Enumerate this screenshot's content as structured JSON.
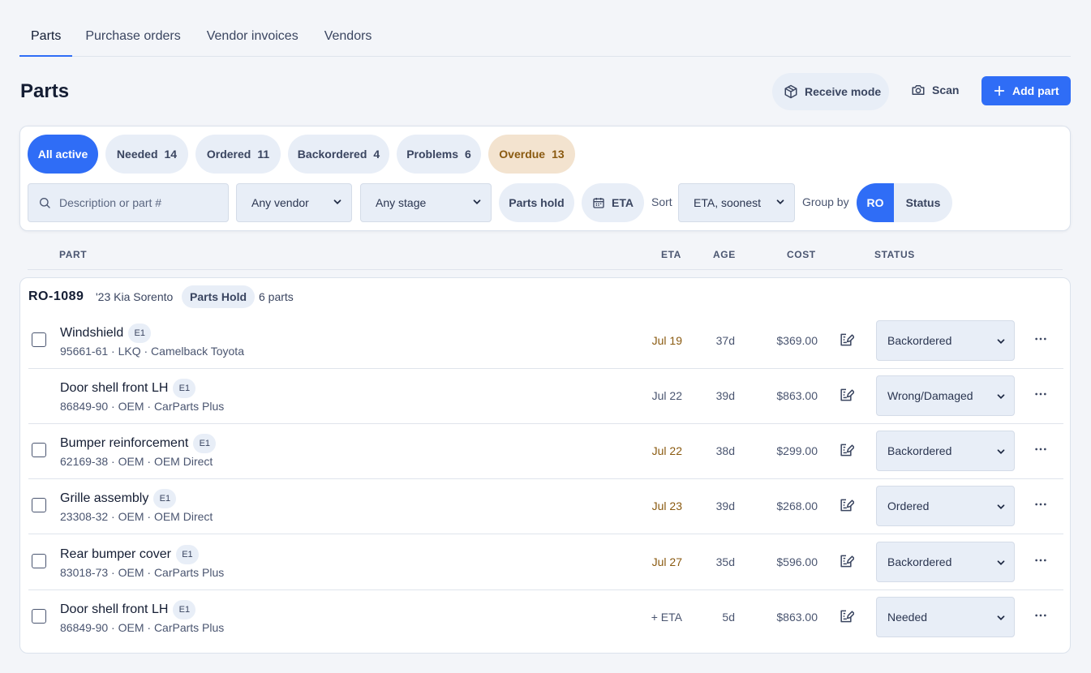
{
  "tabs": [
    "Parts",
    "Purchase orders",
    "Vendor invoices",
    "Vendors"
  ],
  "page_title": "Parts",
  "header_buttons": {
    "receive": "Receive mode",
    "scan": "Scan",
    "add": "Add part"
  },
  "filter_chips": [
    {
      "label": "All active",
      "count": ""
    },
    {
      "label": "Needed",
      "count": "14"
    },
    {
      "label": "Ordered",
      "count": "11"
    },
    {
      "label": "Backordered",
      "count": "4"
    },
    {
      "label": "Problems",
      "count": "6"
    },
    {
      "label": "Overdue",
      "count": "13"
    }
  ],
  "filters": {
    "search_placeholder": "Description or part #",
    "vendor": "Any vendor",
    "stage": "Any stage",
    "parts_hold": "Parts hold",
    "eta": "ETA",
    "sort_label": "Sort",
    "sort_value": "ETA, soonest",
    "group_label": "Group by",
    "group_options": [
      "RO",
      "Status"
    ]
  },
  "columns": {
    "part": "PART",
    "eta": "ETA",
    "age": "AGE",
    "cost": "COST",
    "status": "STATUS"
  },
  "group": {
    "ro": "RO-1089",
    "vehicle": "'23 Kia Sorento",
    "badge": "Parts Hold",
    "count": "6 parts"
  },
  "rows": [
    {
      "name": "Windshield",
      "tag": "E1",
      "sub": "95661-61 · LKQ · Camelback Toyota",
      "eta": "Jul 19",
      "age": "37d",
      "cost": "$369.00",
      "status": "Backordered"
    },
    {
      "name": "Door shell front LH",
      "tag": "E1",
      "sub": "86849-90 · OEM · CarParts Plus",
      "eta": "Jul 22",
      "age": "39d",
      "cost": "$863.00",
      "status": "Wrong/Damaged"
    },
    {
      "name": "Bumper reinforcement",
      "tag": "E1",
      "sub": "62169-38 · OEM · OEM Direct",
      "eta": "Jul 22",
      "age": "38d",
      "cost": "$299.00",
      "status": "Backordered"
    },
    {
      "name": "Grille assembly",
      "tag": "E1",
      "sub": "23308-32 · OEM · OEM Direct",
      "eta": "Jul 23",
      "age": "39d",
      "cost": "$268.00",
      "status": "Ordered"
    },
    {
      "name": "Rear bumper cover",
      "tag": "E1",
      "sub": "83018-73 · OEM · CarParts Plus",
      "eta": "Jul 27",
      "age": "35d",
      "cost": "$596.00",
      "status": "Backordered"
    },
    {
      "name": "Door shell front LH",
      "tag": "E1",
      "sub": "86849-90 · OEM · CarParts Plus",
      "eta": "+ ETA",
      "age": "5d",
      "cost": "$863.00",
      "status": "Needed"
    }
  ],
  "colors": {
    "accent": "#2f6df6",
    "overdue_bg": "#f3e3cf",
    "overdue_text": "#8a5a10",
    "chip_bg": "#e8eef7"
  }
}
